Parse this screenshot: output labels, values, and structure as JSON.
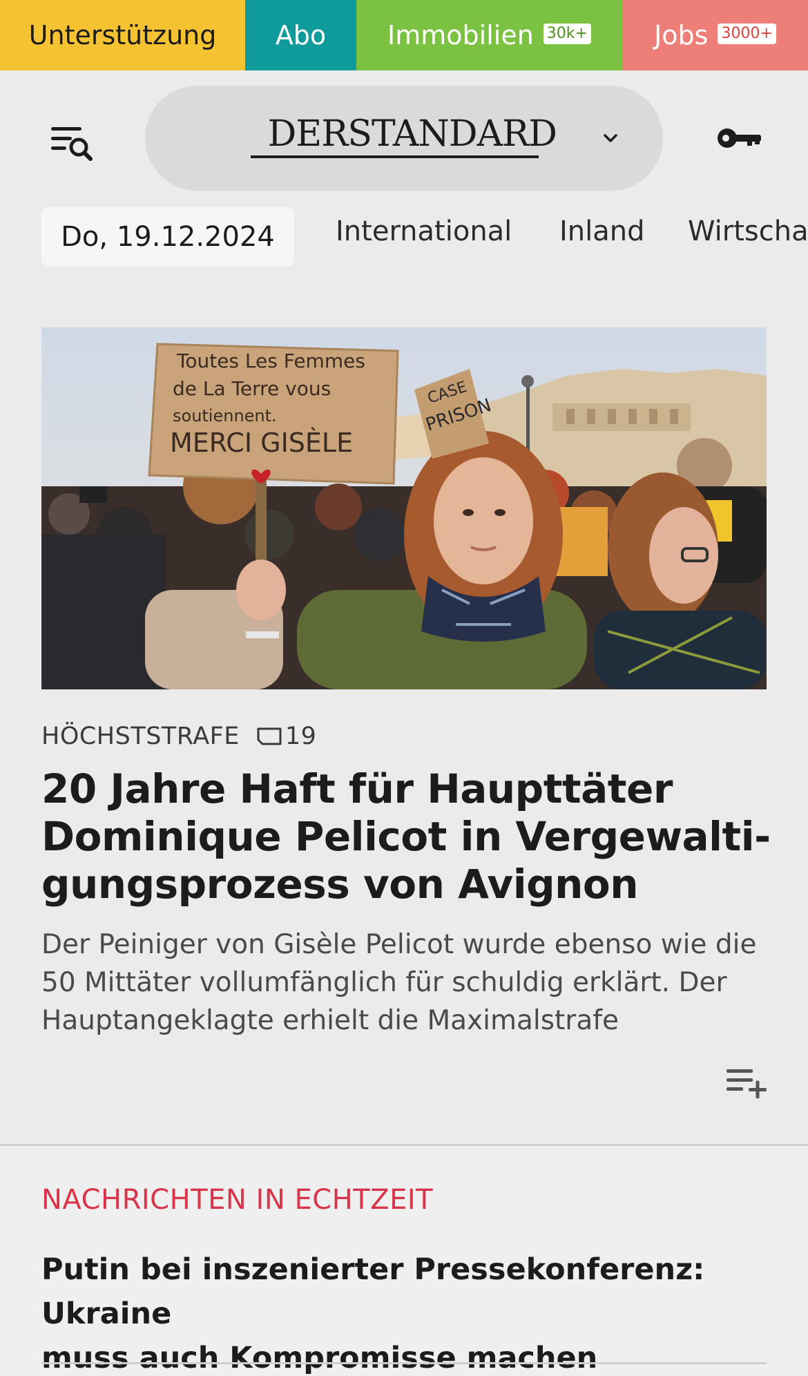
{
  "topbar": {
    "support_label": "Unterstützung",
    "abo_label": "Abo",
    "immobilien_label": "Immobilien",
    "immobilien_badge": "30k+",
    "jobs_label": "Jobs",
    "jobs_badge": "3000+",
    "colors": {
      "support": "#f5c231",
      "abo": "#0f9b9b",
      "immobilien": "#7cc242",
      "jobs": "#ee7f78"
    }
  },
  "header": {
    "logo_text": "DERSTANDARD",
    "menu_icon": "menu-search-icon",
    "edition_icon": "chevron-down-icon",
    "login_icon": "key-icon"
  },
  "nav": {
    "date": "Do, 19.12.2024",
    "items": [
      "International",
      "Inland",
      "Wirtscha"
    ]
  },
  "hero": {
    "image_alt_icon": "protest-photo",
    "sign_text_1": "Toutes Les Femmes",
    "sign_text_2": "de La Terre vous",
    "sign_text_3": "soutiennent.",
    "sign_text_4": "MERCI GISÈLE",
    "sign2_text_1": "CASE",
    "sign2_text_2": "PRISON",
    "kicker": "HÖCHSTSTRAFE",
    "comment_count": "19",
    "headline_line_1": "20 Jahre Haft für Haupttäter",
    "headline_line_2": "Dominique Pelicot in Vergewalti-",
    "headline_line_3": "gungsprozess von Avignon",
    "teaser_line_1": "Der Peiniger von Gisèle Pelicot wurde ebenso wie die",
    "teaser_line_2": "50 Mittäter vollumfänglich für schuldig erklärt. Der",
    "teaser_line_3": "Hauptangeklagte erhielt die Maximalstrafe",
    "playlist_icon": "playlist-add-icon"
  },
  "live": {
    "label": "NACHRICHTEN IN ECHTZEIT",
    "headline_line_1": "Putin bei inszenierter Pressekonferenz: Ukraine",
    "headline_line_2": "muss auch Kompromisse machen",
    "accent_color": "#d8354b"
  }
}
